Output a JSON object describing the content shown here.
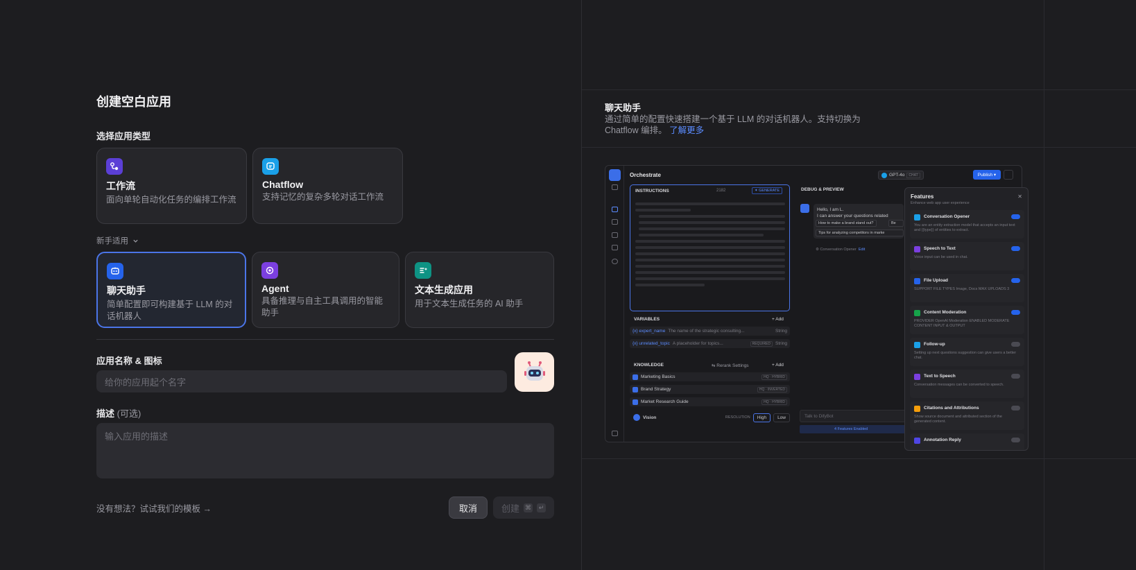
{
  "create": {
    "title": "创建空白应用",
    "select_type_label": "选择应用类型",
    "types_main": [
      {
        "name": "工作流",
        "desc": "面向单轮自动化任务的编排工作流",
        "color": "#5b3fd6"
      },
      {
        "name": "Chatflow",
        "desc": "支持记忆的复杂多轮对话工作流",
        "color": "#1aa0e8"
      }
    ],
    "beginner_label": "新手适用",
    "types_beginner": [
      {
        "name": "聊天助手",
        "desc": "简单配置即可构建基于 LLM 的对话机器人",
        "color": "#2563eb",
        "selected": true
      },
      {
        "name": "Agent",
        "desc": "具备推理与自主工具调用的智能助手",
        "color": "#7b3fe0",
        "selected": false
      },
      {
        "name": "文本生成应用",
        "desc": "用于文本生成任务的 AI 助手",
        "color": "#0e9384",
        "selected": false
      }
    ],
    "name_label": "应用名称 & 图标",
    "name_placeholder": "给你的应用起个名字",
    "desc_label": "描述",
    "desc_optional": "(可选)",
    "desc_placeholder": "输入应用的描述",
    "template_link": "没有想法？试试我们的模板 →",
    "cancel": "取消",
    "create": "创建",
    "kbd_cmd": "⌘",
    "kbd_enter": "↵"
  },
  "preview": {
    "title": "聊天助手",
    "desc": "通过简单的配置快速搭建一个基于 LLM 的对话机器人。支持切换为 Chatflow 编排。",
    "learn_more": "了解更多",
    "mock": {
      "orchestrate": "Orchestrate",
      "model": "GPT-4o",
      "model_tag": "CHAT",
      "publish": "Publish ▾",
      "instructions": "INSTRUCTIONS",
      "char_count": "2182",
      "generate": "✦ GENERATE",
      "variables": "VARIABLES",
      "add": "+ Add",
      "vars": [
        {
          "name": "{x} expert_name",
          "desc": "The name of the strategic consulting...",
          "tag": "",
          "type": "String"
        },
        {
          "name": "{x} unrelated_topic",
          "desc": "A placeholder for topics...",
          "tag": "REQUIRED",
          "type": "String"
        }
      ],
      "knowledge": "KNOWLEDGE",
      "rerank": "⇆ Rerank Settings",
      "kb": [
        {
          "name": "Marketing Basics",
          "tag": "HQ · HYBRID"
        },
        {
          "name": "Brand Strategy",
          "tag": "HQ · INVERTED"
        },
        {
          "name": "Market Research Guide",
          "tag": "HQ · HYBRID"
        }
      ],
      "vision": "Vision",
      "resolution": "RESOLUTION",
      "high": "High",
      "low": "Low",
      "debug": "DEBUG & PREVIEW",
      "bubble_1": "Hello, I am L.",
      "bubble_2": "I can answer your questions related",
      "chip_1": "How to make a brand stand out?",
      "chip_2": "Be",
      "chip_3": "Tips for analyzing competitors in marke",
      "opener": "⚙ Conversation Opener",
      "edit": "Edit",
      "talk": "Talk to DifyBot",
      "features_enabled": "4 Features Enabled",
      "features_title": "Features",
      "features_sub": "Enhance web app user experience",
      "features": [
        {
          "name": "Conversation Opener",
          "desc": "You are an entity extraction model that accepts an input text and {{type}} of entities to extract.",
          "color": "#1aa0e8",
          "on": true
        },
        {
          "name": "Speech to Text",
          "desc": "Voice input can be used in chat.",
          "color": "#7b3fe0",
          "on": true
        },
        {
          "name": "File Upload",
          "desc": "SUPPORT FILE TYPES  Image, Docs     MAX UPLOADS  3",
          "color": "#2563eb",
          "on": true
        },
        {
          "name": "Content Moderation",
          "desc": "PROVIDER  OpenAI Moderation     ENABLED MODERATE CONTENT  INPUT & OUTPUT",
          "color": "#16a34a",
          "on": true
        },
        {
          "name": "Follow-up",
          "desc": "Setting up next questions suggestion can give users a better chat.",
          "color": "#1aa0e8",
          "on": false
        },
        {
          "name": "Text to Speech",
          "desc": "Conversation messages can be converted to speech.",
          "color": "#7b3fe0",
          "on": false
        },
        {
          "name": "Citations and Attributions",
          "desc": "Show source document and attributed section of the generated content.",
          "color": "#f59e0b",
          "on": false
        },
        {
          "name": "Annotation Reply",
          "desc": "",
          "color": "#4f46e5",
          "on": false
        }
      ]
    }
  }
}
